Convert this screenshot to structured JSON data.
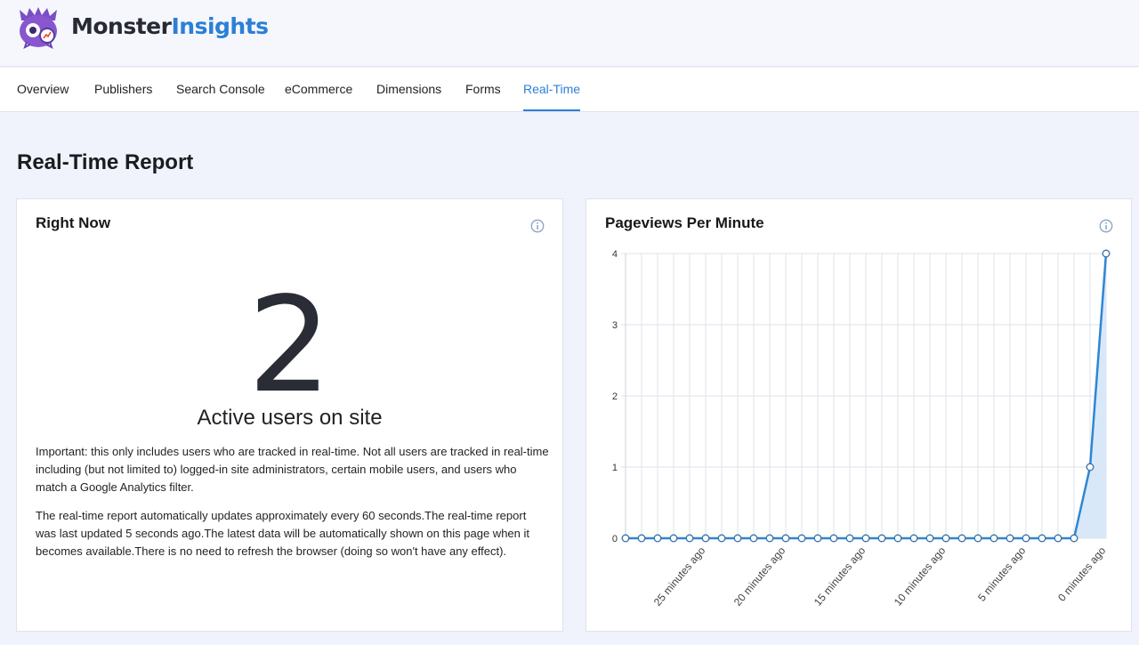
{
  "brand": {
    "part1": "Monster",
    "part2": "Insights"
  },
  "tabs": [
    {
      "label": "Overview",
      "active": false
    },
    {
      "label": "Publishers",
      "active": false
    },
    {
      "label": "Search Console",
      "active": false
    },
    {
      "label": "eCommerce",
      "active": false
    },
    {
      "label": "Dimensions",
      "active": false
    },
    {
      "label": "Forms",
      "active": false
    },
    {
      "label": "Real-Time",
      "active": true
    }
  ],
  "page_title": "Real-Time Report",
  "right_now": {
    "title": "Right Now",
    "active_users": "2",
    "active_label": "Active users on site",
    "note1": "Important: this only includes users who are tracked in real-time. Not all users are tracked in real-time including (but not limited to) logged-in site administrators, certain mobile users, and users who match a Google Analytics filter.",
    "note2": "The real-time report automatically updates approximately every 60 seconds.The real-time report was last updated 5 seconds ago.The latest data will be automatically shown on this page when it becomes available.There is no need to refresh the browser (doing so won't have any effect)."
  },
  "pageviews": {
    "title": "Pageviews Per Minute"
  },
  "colors": {
    "accent": "#2b7fd6",
    "line": "#2e86d4",
    "fill": "#d5e6f7",
    "grid": "#dde3ea"
  },
  "chart_data": {
    "type": "line",
    "title": "Pageviews Per Minute",
    "x": [
      30,
      29,
      28,
      27,
      26,
      25,
      24,
      23,
      22,
      21,
      20,
      19,
      18,
      17,
      16,
      15,
      14,
      13,
      12,
      11,
      10,
      9,
      8,
      7,
      6,
      5,
      4,
      3,
      2,
      1,
      0
    ],
    "x_unit": "minutes ago",
    "tick_labels": [
      "25 minutes ago",
      "20 minutes ago",
      "15 minutes ago",
      "10 minutes ago",
      "5 minutes ago",
      "0 minutes ago"
    ],
    "tick_positions": [
      25,
      20,
      15,
      10,
      5,
      0
    ],
    "series": [
      {
        "values": [
          0,
          0,
          0,
          0,
          0,
          0,
          0,
          0,
          0,
          0,
          0,
          0,
          0,
          0,
          0,
          0,
          0,
          0,
          0,
          0,
          0,
          0,
          0,
          0,
          0,
          0,
          0,
          0,
          0,
          1,
          4
        ]
      }
    ],
    "ylim": [
      0,
      4
    ],
    "yticks": [
      0,
      1,
      2,
      3,
      4
    ],
    "grid": true,
    "legend": "none"
  }
}
